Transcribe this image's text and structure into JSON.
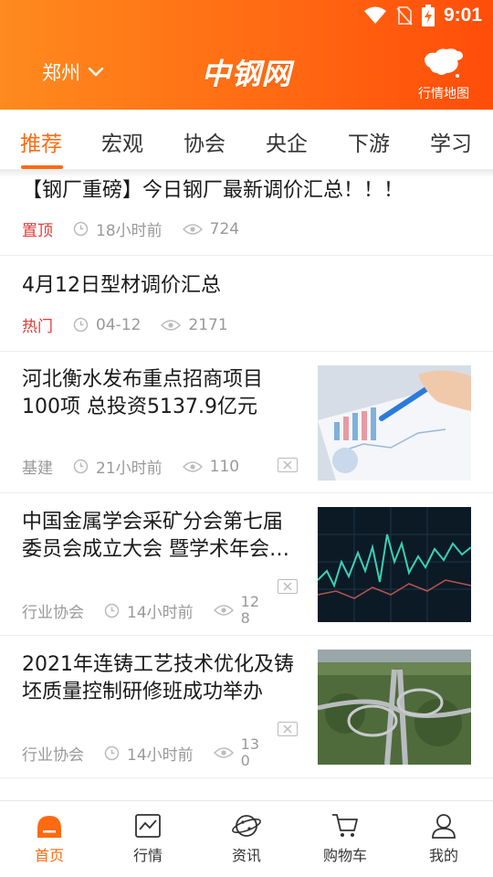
{
  "status_bar": {
    "time": "9:01"
  },
  "header": {
    "city": "郑州",
    "logo": "中钢网",
    "map_label": "行情地图",
    "accent_color": "#ff6a12"
  },
  "tabs": [
    {
      "label": "推荐",
      "active": true
    },
    {
      "label": "宏观",
      "active": false
    },
    {
      "label": "协会",
      "active": false
    },
    {
      "label": "央企",
      "active": false
    },
    {
      "label": "下游",
      "active": false
    },
    {
      "label": "学习",
      "active": false
    }
  ],
  "feed": [
    {
      "title": "【钢厂重磅】今日钢厂最新调价汇总！！！",
      "tag": "置顶",
      "time": "18小时前",
      "views": "724"
    },
    {
      "title": "4月12日型材调价汇总",
      "tag": "热门",
      "time": "04-12",
      "views": "2171"
    },
    {
      "title": "河北衡水发布重点招商项目100项 总投资5137.9亿元",
      "tag": "基建",
      "time": "21小时前",
      "views": "110",
      "thumb": "chart-paper"
    },
    {
      "title": "中国金属学会采矿分会第七届委员会成立大会 暨学术年会召开",
      "tag": "行业协会",
      "time": "14小时前",
      "views_line1": "12",
      "views_line2": "8",
      "thumb": "stock-chart"
    },
    {
      "title": "2021年连铸工艺技术优化及铸坯质量控制研修班成功举办",
      "tag": "行业协会",
      "time": "14小时前",
      "views_line1": "13",
      "views_line2": "0",
      "thumb": "highway"
    }
  ],
  "bottom_nav": [
    {
      "label": "首页",
      "icon": "home-icon",
      "active": true
    },
    {
      "label": "行情",
      "icon": "chart-icon",
      "active": false
    },
    {
      "label": "资讯",
      "icon": "planet-icon",
      "active": false
    },
    {
      "label": "购物车",
      "icon": "cart-icon",
      "active": false
    },
    {
      "label": "我的",
      "icon": "user-icon",
      "active": false
    }
  ]
}
